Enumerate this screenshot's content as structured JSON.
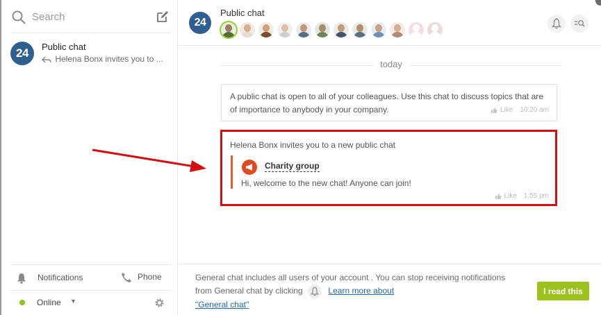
{
  "sidebar": {
    "search_placeholder": "Search",
    "chats": [
      {
        "avatar_text": "24",
        "title": "Public chat",
        "preview": "Helena Bonx invites you to ..."
      }
    ],
    "notifications_label": "Notifications",
    "phone_label": "Phone",
    "status_label": "Online",
    "status_color": "#8fc31f"
  },
  "header": {
    "avatar_text": "24",
    "title": "Public chat"
  },
  "messages": {
    "day_label": "today",
    "system_message": {
      "text": "A public chat is open to all of your colleagues. Use this chat to discuss topics that are of importance to anybody in your company.",
      "like_label": "Like",
      "time": "10:20 am"
    },
    "invite_message": {
      "title": "Helena Bonx invites you to a new public chat",
      "group_name": "Charity group",
      "quote_text": "Hi, welcome to the new chat! Anyone can join!",
      "like_label": "Like",
      "time": "1:55 pm",
      "highlight_color": "#d40f12"
    }
  },
  "footer": {
    "text_before": "General chat includes all users of your account . You can stop receiving notifications from General chat by clicking",
    "learn_more": "Learn more about",
    "general_chat_link": "\"General chat\"",
    "button_label": "I read this",
    "button_color": "#9bc21f"
  }
}
